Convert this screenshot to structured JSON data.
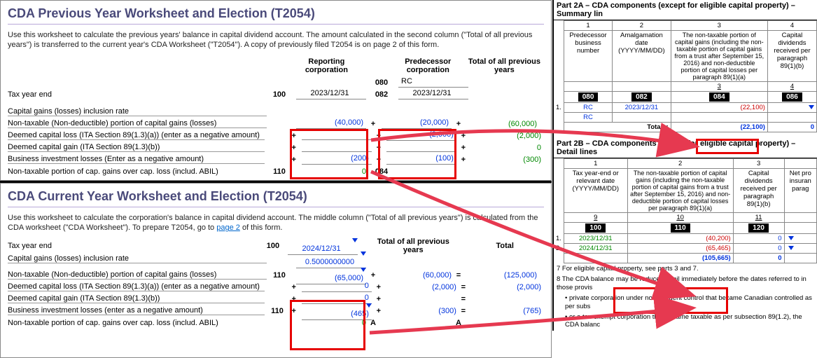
{
  "prev": {
    "title": "CDA Previous Year Worksheet and Election (T2054)",
    "intro": "Use this worksheet to calculate the previous years' balance in capital dividend account. The amount calculated in the second column (\"Total of all previous years\") is transferred to the current year's CDA Worksheet (\"T2054\"). A copy of previously filed T2054 is on page 2 of this form.",
    "col1": "Reporting corporation",
    "col2": "Predecessor corporation",
    "col3": "Total of all previous years",
    "code080": "080",
    "code080_val": "RC",
    "tye_label": "Tax year end",
    "tye_code": "100",
    "tye_val1": "2023/12/31",
    "code082": "082",
    "tye_val2": "2023/12/31",
    "rate_label": "Capital gains (losses) inclusion rate",
    "r1": "Non-taxable (Non-deductible) portion of capital gains (losses)",
    "r1_v1": "(40,000)",
    "r1_v2": "(20,000)",
    "r1_v3": "(60,000)",
    "r2": "Deemed capital loss (ITA Section 89(1.3)(a)) (enter as a negative amount)",
    "r2_v2": "(2,000)",
    "r2_v3": "(2,000)",
    "r3": "Deemed capital gain (ITA Section 89(1.3)(b))",
    "r3_v3": "0",
    "r4": "Business investment losses (Enter as a negative amount)",
    "r4_v1": "(200)",
    "r4_v2": "(100)",
    "r4_v3": "(300)",
    "r5": "Non-taxable portion of cap. gains over cap. loss (includ. ABIL)",
    "r5_code": "110",
    "r5_v1": "0",
    "r5_code2": "084"
  },
  "curr": {
    "title": "CDA Current Year Worksheet and Election (T2054)",
    "intro_a": "Use this worksheet to calculate the corporation's balance in capital dividend account. The middle column (\"Total of all previous years\") is calculated from the CDA worksheet (\"CDA Worksheet\"). To prepare T2054, go to ",
    "intro_link": "page 2",
    "intro_b": " of this form.",
    "tye_label": "Tax year end",
    "tye_code": "100",
    "tye_val": "2024/12/31",
    "col2": "Total of all previous years",
    "col3": "Total",
    "rate_label": "Capital gains (losses) inclusion rate",
    "rate_val": "0.5000000000",
    "r1": "Non-taxable (Non-deductible) portion of capital gains (losses)",
    "r1_code": "110",
    "r1_v1": "(65,000)",
    "r1_v2": "(60,000)",
    "r1_v3": "(125,000)",
    "r2": "Deemed capital loss (ITA Section 89(1.3)(a)) (enter as a negative amount)",
    "r2_v1": "0",
    "r2_v2": "(2,000)",
    "r2_v3": "(2,000)",
    "r3": "Deemed capital gain (ITA Section 89(1.3)(b))",
    "r3_v1": "0",
    "r4": "Business investment losses (enter as a negative amount)",
    "r4_code": "110",
    "r4_v1": "(465)",
    "r4_v2": "(300)",
    "r4_v3": "(765)",
    "r5": "Non-taxable portion of cap. gains over cap. loss (includ. ABIL)",
    "r5_v1": "0",
    "r5_A": "A",
    "r5_A2": "A"
  },
  "p2a": {
    "title": "Part 2A – CDA components (except for eligible capital property) – Summary lin",
    "c1": "1",
    "c2": "2",
    "c3": "3",
    "c4": "4",
    "h1": "Predecessor business number",
    "h2": "Amalgamation date (YYYY/MM/DD)",
    "h3": "The non-taxable portion of capital gains (including the non-taxable portion of capital gains from a trust after September 15, 2016) and non-deductible portion of capital losses per paragraph 89(1)(a)",
    "h4": "Capital dividends received per paragraph 89(1)(b)",
    "sub3": "3",
    "sub4": "4",
    "code080": "080",
    "code082": "082",
    "code084": "084",
    "code086": "086",
    "row1_c1": "RC",
    "row1_c2": "2023/12/31",
    "row1_c3": "(22,100)",
    "row2_c1": "RC",
    "totals": "Totals:",
    "tot_c3": "(22,100)",
    "tot_c4": "0"
  },
  "p2b": {
    "title": "Part 2B – CDA components (except for eligible capital property) – Detail lines",
    "c1": "1",
    "c2": "2",
    "c3": "3",
    "h1": "Tax year-end or relevant date (YYYY/MM/DD)",
    "h2": "The non-taxable portion of capital gains (including the non-taxable portion of capital gains from a trust after September 15, 2016) and non-deductible portion of capital losses per paragraph 89(1)(a)",
    "h3": "Capital dividends received per paragraph 89(1)(b)",
    "h4": "Net pro insuran parag",
    "sub9": "9",
    "sub10": "10",
    "sub11": "11",
    "code100": "100",
    "code110": "110",
    "code120": "120",
    "row1_c1": "2023/12/31",
    "row1_c2": "(40,200)",
    "row1_c3": "0",
    "row2_c1": "2024/12/31",
    "row2_c2": "(65,465)",
    "row2_c3": "0",
    "tot_c2": "(105,665)",
    "tot_c3": "0",
    "fn7": "7 For eligible capital property, see parts 3 and 7.",
    "fn8": "8 The CDA balance may be reduced to nil immediately before the dates referred to in those provis",
    "fn8a": "private corporation under non-resident control that became Canadian controlled as per subs",
    "fn8b": "or a tax-exempt corporation that became taxable as per subsection 89(1.2), the CDA balanc"
  }
}
